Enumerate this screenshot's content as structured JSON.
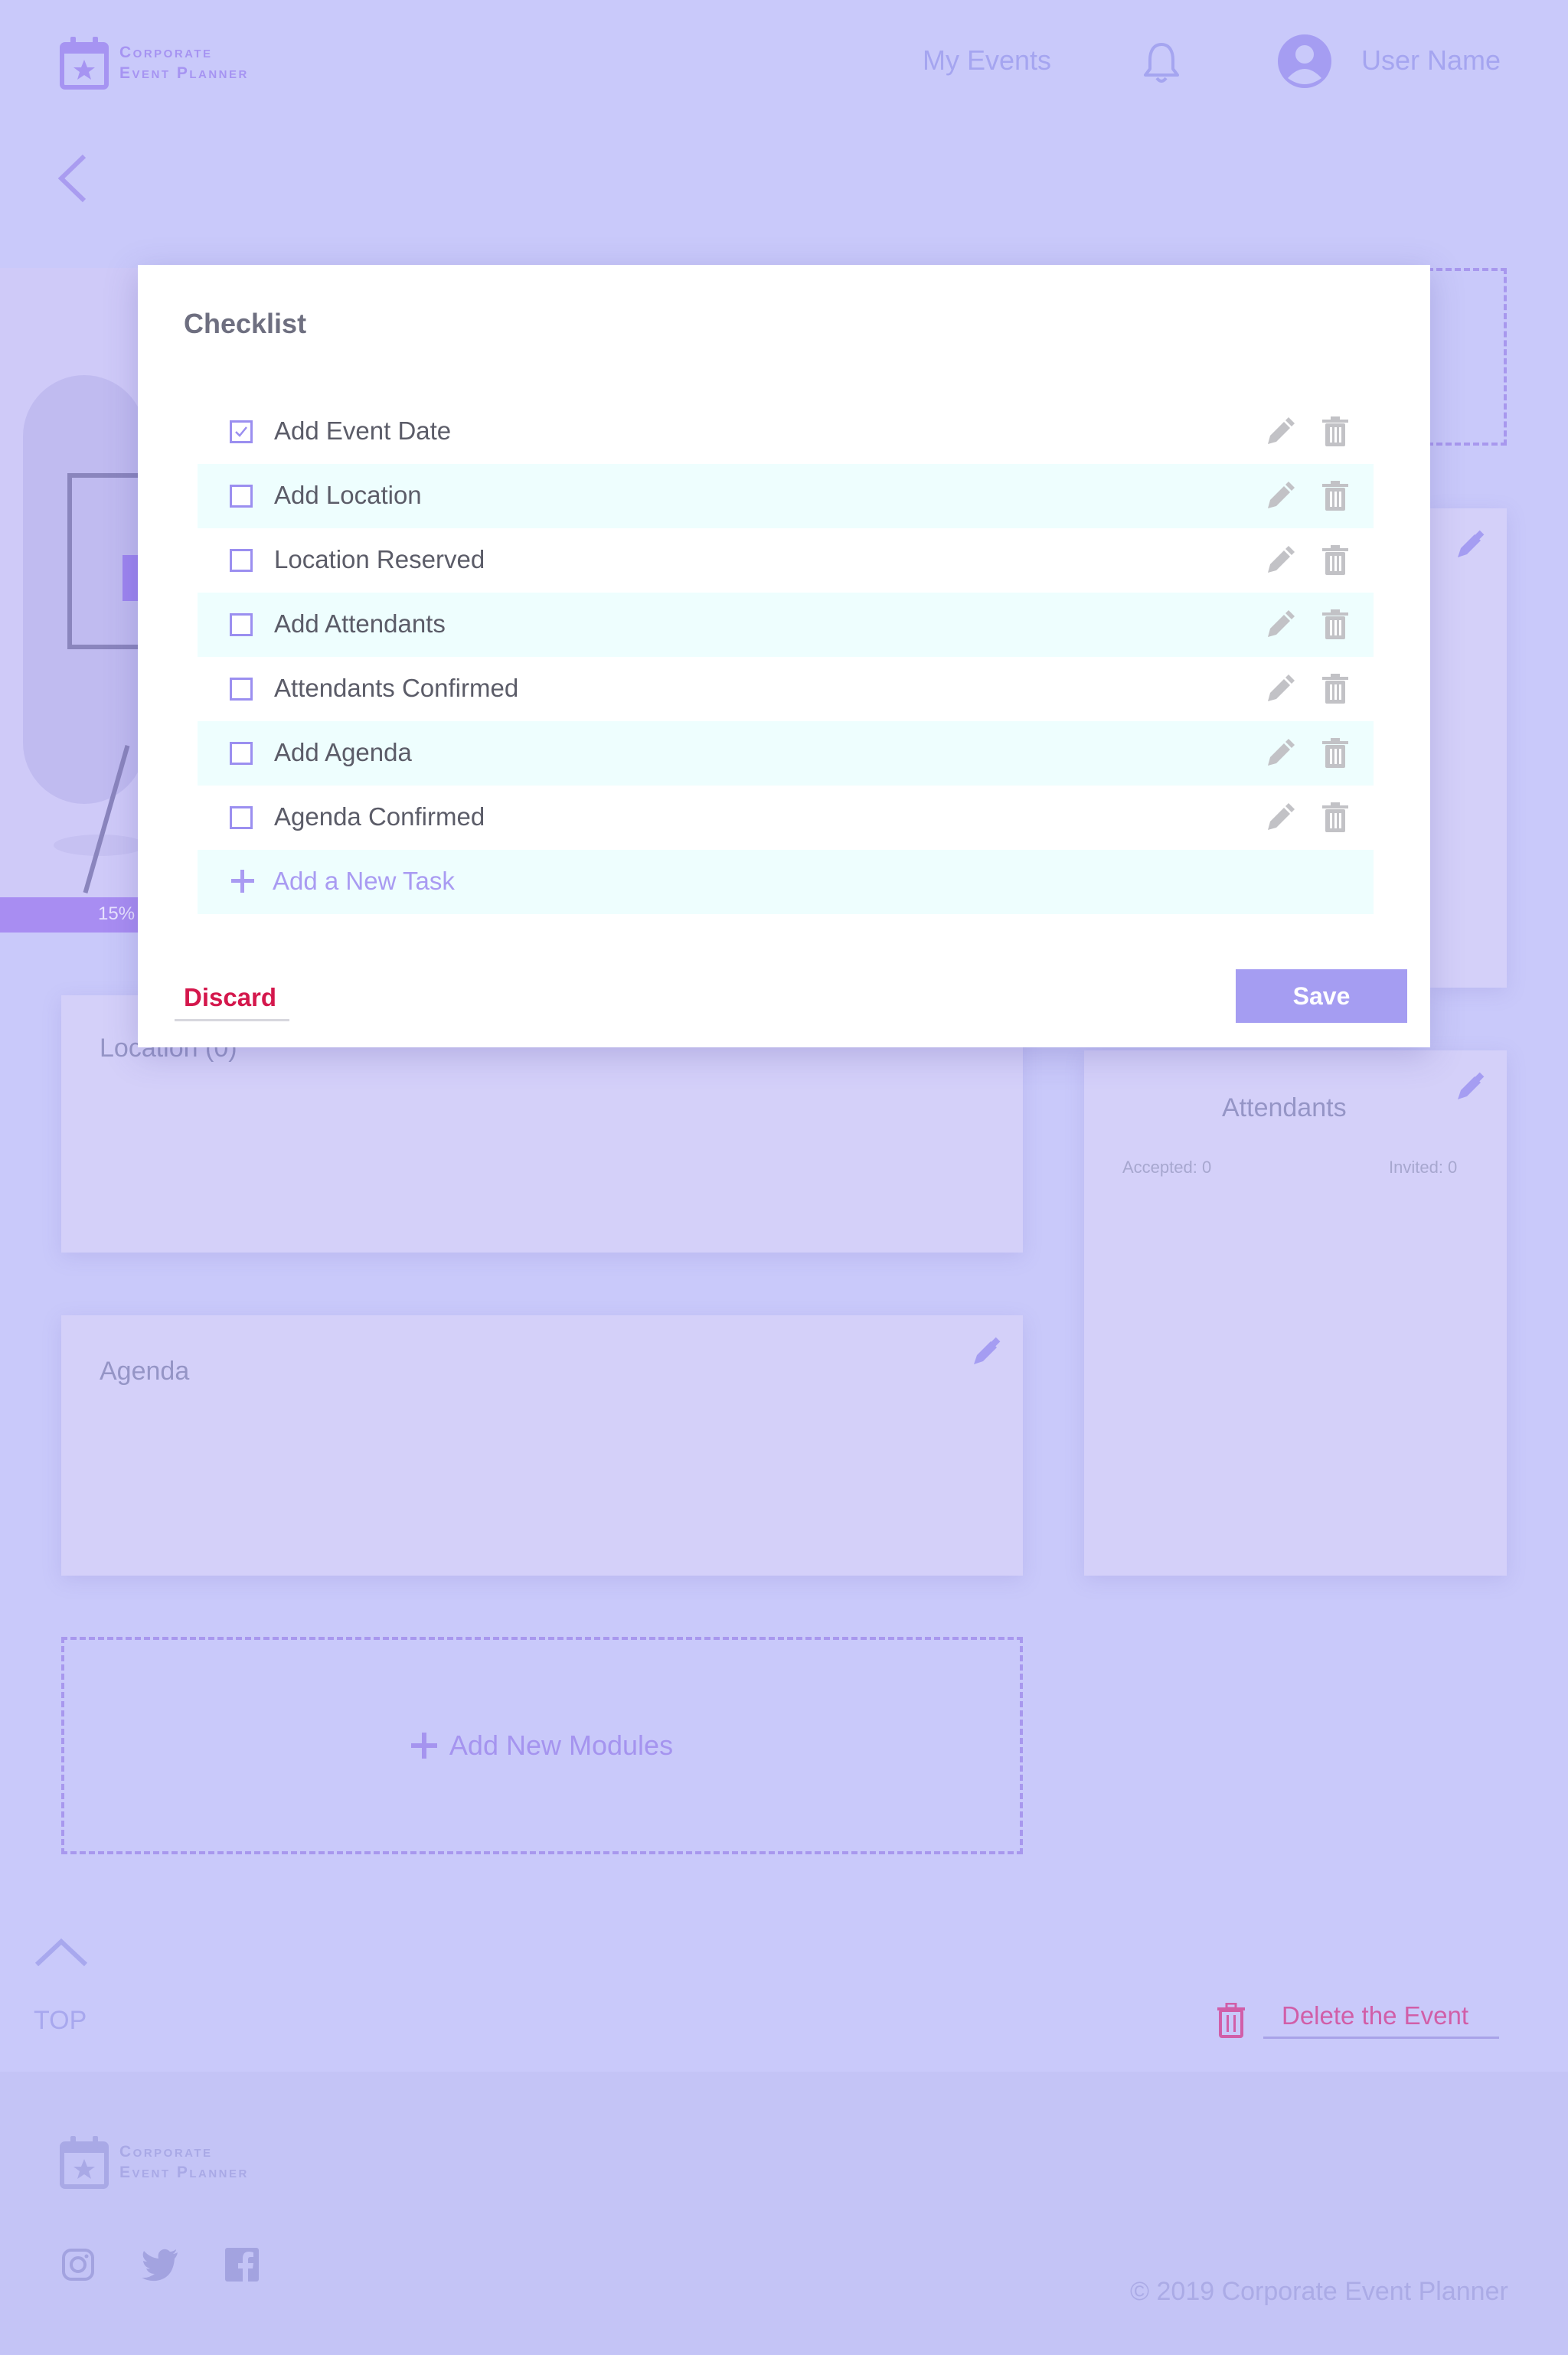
{
  "header": {
    "logo_line1": "Corporate",
    "logo_line2": "Event Planner",
    "nav_my_events": "My Events",
    "user_name": "User Name"
  },
  "event": {
    "progress_label": "15%",
    "progress": 0.15
  },
  "cards": {
    "location_title": "Location (0)",
    "agenda_title": "Agenda",
    "attendants_title": "Attendants",
    "attendants_accepted": "Accepted: 0",
    "attendants_invited": "Invited: 0"
  },
  "add_modules_label": "Add New Modules",
  "top_label": "TOP",
  "delete_event_label": "Delete the Event",
  "footer": {
    "logo_line1": "Corporate",
    "logo_line2": "Event Planner",
    "copyright": "© 2019 Corporate Event Planner"
  },
  "modal": {
    "title": "Checklist",
    "tasks": [
      {
        "label": "Add Event Date",
        "checked": true
      },
      {
        "label": "Add Location",
        "checked": false
      },
      {
        "label": "Location Reserved",
        "checked": false
      },
      {
        "label": "Add Attendants",
        "checked": false
      },
      {
        "label": "Attendants Confirmed",
        "checked": false
      },
      {
        "label": "Add Agenda",
        "checked": false
      },
      {
        "label": "Agenda Confirmed",
        "checked": false
      }
    ],
    "add_task_label": "Add a New Task",
    "discard_label": "Discard",
    "save_label": "Save"
  },
  "colors": {
    "accent": "#a59df2",
    "danger": "#d4174c",
    "row_alt": "#eefefe",
    "overlay_bg": "#c9c9fa"
  },
  "icons": [
    "calendar-star-icon",
    "bell-icon",
    "user-avatar-icon",
    "back-arrow-icon",
    "pencil-icon",
    "trash-icon",
    "plus-icon",
    "chevron-up-icon",
    "instagram-icon",
    "twitter-icon",
    "facebook-icon"
  ]
}
